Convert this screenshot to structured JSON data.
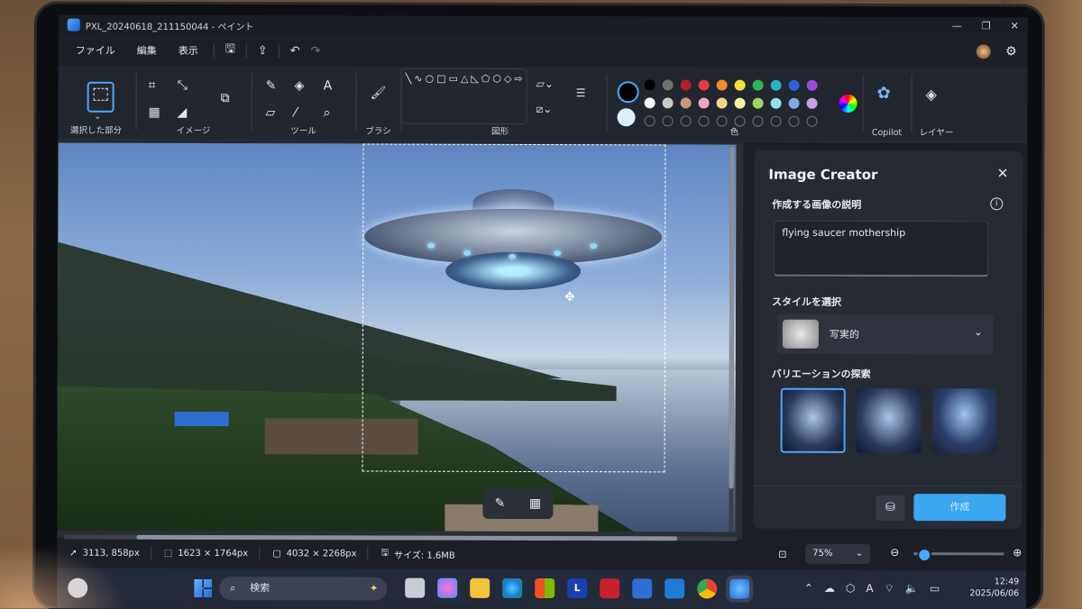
{
  "window": {
    "title": "PXL_20240618_211150044 - ペイント",
    "controls": [
      "—",
      "❐",
      "✕"
    ]
  },
  "menu": {
    "file": "ファイル",
    "edit": "編集",
    "view": "表示"
  },
  "ribbon": {
    "selection_label": "選択した部分",
    "image_label": "イメージ",
    "tools_label": "ツール",
    "brush_label": "ブラシ",
    "shapes_label": "図形",
    "colors_label": "色",
    "copilot_label": "Copilot",
    "layers_label": "レイヤー",
    "shapes_glyphs": "╲∿○□▭△◺⬠⬡◇⇨⇧⇩✦☆◯◯◯",
    "palette_row1": [
      "#000000",
      "#6f6f6f",
      "#b01e2c",
      "#e23b3b",
      "#f08a2b",
      "#f2e23b",
      "#33b34d",
      "#29b5c9",
      "#2a63d6",
      "#9a4bd6"
    ],
    "palette_row2": [
      "#ffffff",
      "#c9c9c9",
      "#c49a7a",
      "#f2a7c4",
      "#f5d58c",
      "#f5f2a0",
      "#9bd66b",
      "#8fe2ea",
      "#7ea8e6",
      "#c6a0e6"
    ],
    "primary_color": "#000000",
    "secondary_color": "#dfeef8"
  },
  "canvas": {
    "float_toolbar": [
      "✎",
      "▦"
    ]
  },
  "panel": {
    "title": "Image Creator",
    "description_label": "作成する画像の説明",
    "prompt_text": "flying saucer mothership",
    "style_label": "スタイルを選択",
    "style_value": "写実的",
    "variations_label": "バリエーションの探索",
    "generate_button": "作成"
  },
  "status": {
    "cursor_pos": "3113, 858px",
    "selection_size": "1623 × 1764px",
    "canvas_size": "4032 × 2268px",
    "file_size": "サイズ: 1.6MB",
    "zoom": "75%"
  },
  "taskbar": {
    "search_placeholder": "検索",
    "time": "12:49",
    "date": "2025/06/06"
  }
}
